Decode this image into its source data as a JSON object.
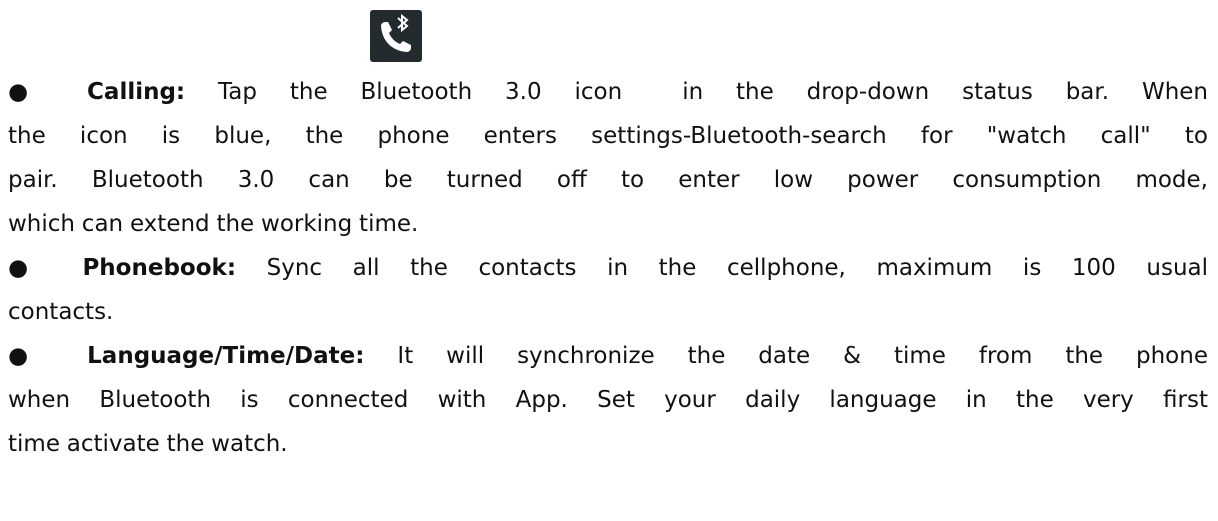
{
  "bullet": "●",
  "calling": {
    "label": "Calling:",
    "text_before_icon": "Tap the Bluetooth 3.0 icon",
    "text_after_icon": "in the drop-down status bar. When",
    "line2": "the icon is blue, the phone enters settings-Bluetooth-search for \"watch call\" to",
    "line3": "pair. Bluetooth 3.0 can be turned off to enter low power consumption mode,",
    "line4": "which can extend the working time.",
    "icon": "bluetooth-call-icon",
    "icon_color": "#232b2f"
  },
  "phonebook": {
    "label": "Phonebook:",
    "line1": "Sync all the contacts in the cellphone, maximum is 100 usual",
    "line2": "contacts."
  },
  "language": {
    "label": "Language/Time/Date:",
    "line1": "It will synchronize the date & time from the phone",
    "line2": "when Bluetooth is connected with App. Set your daily language in the very first",
    "line3": "time activate the watch."
  }
}
